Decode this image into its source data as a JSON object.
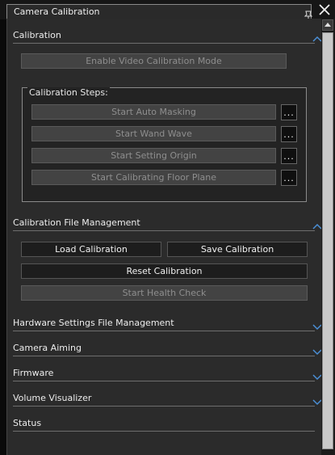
{
  "window": {
    "title": "Camera Calibration"
  },
  "sections": {
    "calibration": {
      "title": "Calibration",
      "enable_video_button": "Enable Video Calibration Mode",
      "steps_label": "Calibration Steps:",
      "steps": [
        {
          "label": "Start Auto Masking",
          "more": "..."
        },
        {
          "label": "Start Wand Wave",
          "more": "..."
        },
        {
          "label": "Start Setting Origin",
          "more": "..."
        },
        {
          "label": "Start Calibrating Floor Plane",
          "more": "..."
        }
      ]
    },
    "file_mgmt": {
      "title": "Calibration File Management",
      "load": "Load Calibration",
      "save": "Save Calibration",
      "reset": "Reset Calibration",
      "health": "Start Health Check"
    },
    "hardware": {
      "title": "Hardware Settings File Management"
    },
    "aiming": {
      "title": "Camera Aiming"
    },
    "firmware": {
      "title": "Firmware"
    },
    "volume": {
      "title": "Volume Visualizer"
    },
    "status": {
      "title": "Status"
    }
  },
  "colors": {
    "chevron": "#4a8fd6",
    "panel": "#2b2b2b",
    "titlebar": "#161616"
  },
  "icons": {
    "pin": "pin-icon",
    "close": "close-icon",
    "chevron_up": "chevron-up-icon",
    "chevron_down": "chevron-down-icon",
    "scroll_up": "scroll-up-icon"
  }
}
